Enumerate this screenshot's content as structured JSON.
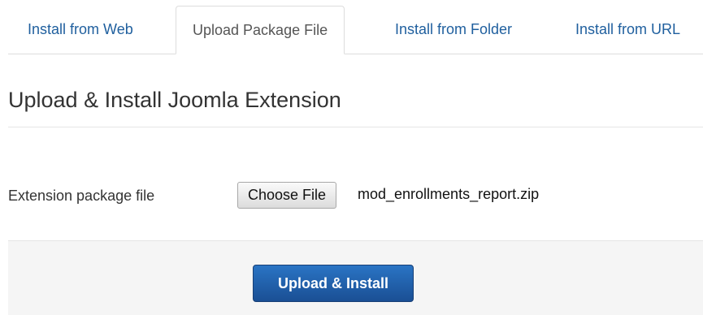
{
  "tabs": [
    {
      "label": "Install from Web",
      "active": false
    },
    {
      "label": "Upload Package File",
      "active": true
    },
    {
      "label": "Install from Folder",
      "active": false
    },
    {
      "label": "Install from URL",
      "active": false
    }
  ],
  "page": {
    "title": "Upload & Install Joomla Extension"
  },
  "form": {
    "field_label": "Extension package file",
    "choose_button_label": "Choose File",
    "selected_file": "mod_enrollments_report.zip",
    "submit_label": "Upload & Install"
  },
  "colors": {
    "tab_link": "#1f5f9e",
    "primary_button": "#1f5ba6",
    "actions_background": "#f5f5f5"
  }
}
